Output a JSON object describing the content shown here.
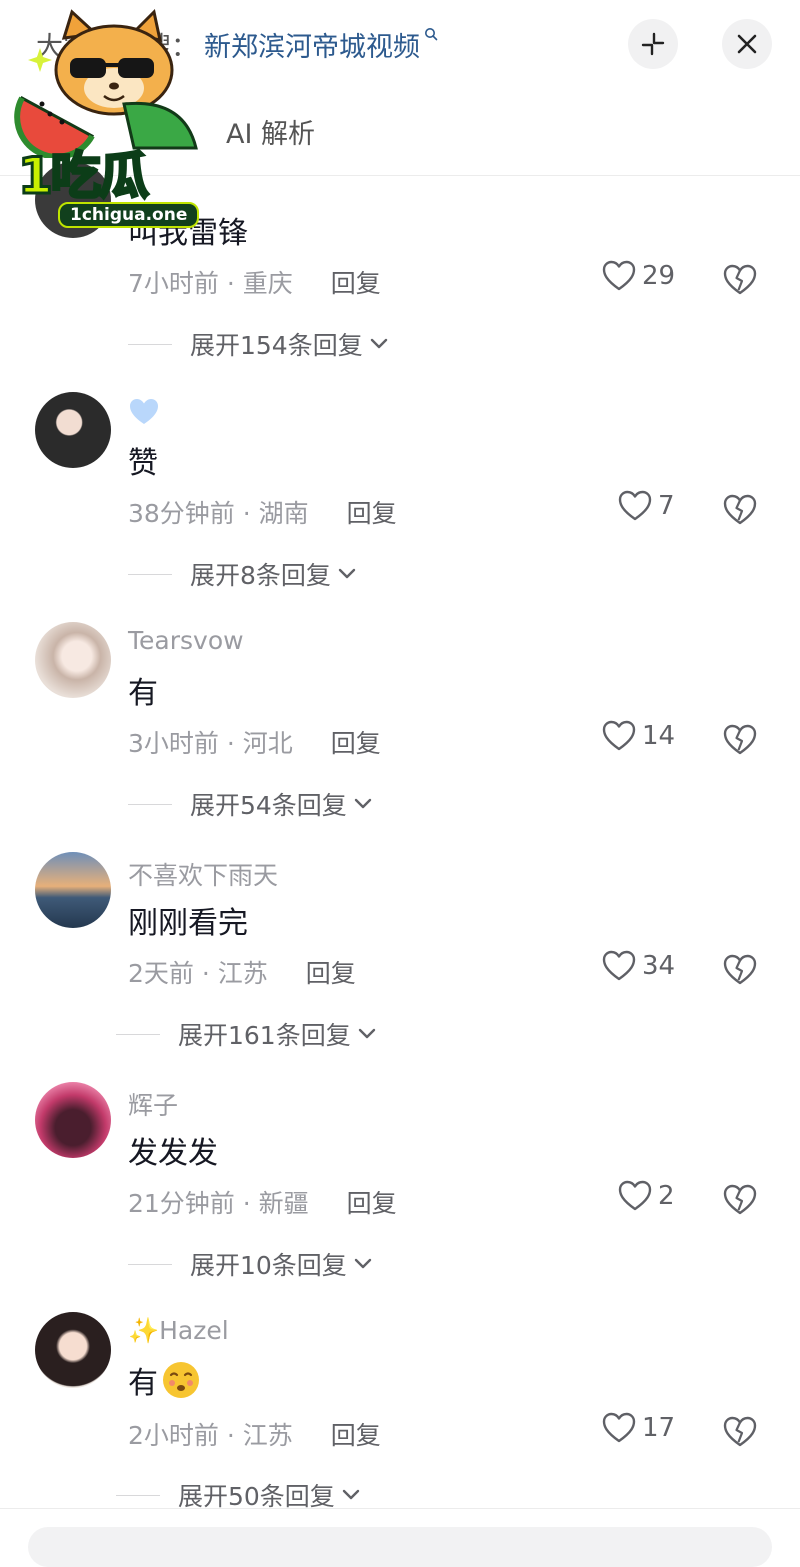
{
  "header": {
    "search_prefix": "大家都在搜：",
    "search_query": "新郑滨河帝城视频",
    "ai_label": "AI 解析"
  },
  "watermark": {
    "brand": "1吃瓜",
    "domain": "1chigua.one"
  },
  "comments": [
    {
      "username": "",
      "text": "叫我雷锋",
      "time": "7小时前",
      "location": "重庆",
      "reply": "回复",
      "likes": "29",
      "expand": "展开154条回复"
    },
    {
      "username": "",
      "badge": "light-blue-heart",
      "text": "赞",
      "time": "38分钟前",
      "location": "湖南",
      "reply": "回复",
      "likes": "7",
      "expand": "展开8条回复"
    },
    {
      "username": "Tearsvow",
      "text": "有",
      "time": "3小时前",
      "location": "河北",
      "reply": "回复",
      "likes": "14",
      "expand": "展开54条回复"
    },
    {
      "username": "不喜欢下雨天",
      "text": "刚刚看完",
      "time": "2天前",
      "location": "江苏",
      "reply": "回复",
      "likes": "34",
      "expand": "展开161条回复"
    },
    {
      "username": "辉子",
      "text": "发发发",
      "time": "21分钟前",
      "location": "新疆",
      "reply": "回复",
      "likes": "2",
      "expand": "展开10条回复"
    },
    {
      "username": "✨Hazel",
      "text": "有",
      "emoji": "face-emoji",
      "time": "2小时前",
      "location": "江苏",
      "reply": "回复",
      "likes": "17",
      "expand": "展开50条回复"
    }
  ],
  "colors": {
    "accent_link": "#2d5a8e",
    "muted_text": "#9a9ba1",
    "primary_text": "#161823"
  }
}
